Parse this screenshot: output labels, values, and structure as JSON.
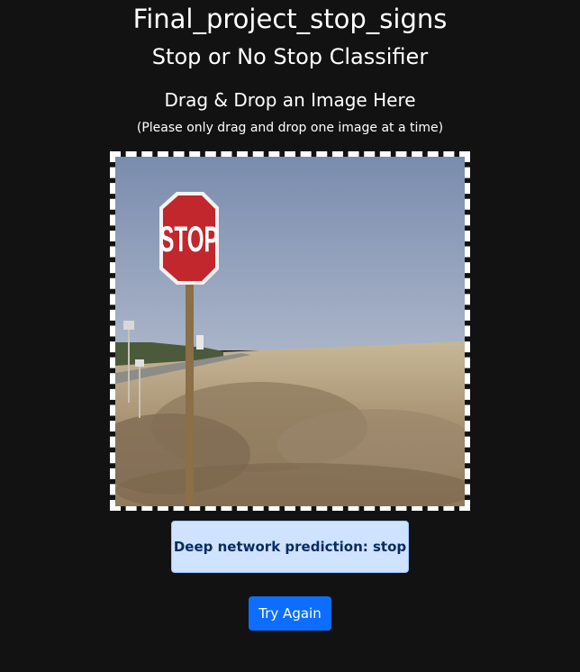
{
  "header": {
    "title": "Final_project_stop_signs",
    "subtitle": "Stop or No Stop Classifier"
  },
  "drop_zone": {
    "heading": "Drag & Drop an Image Here",
    "hint": "(Please only drag and drop one image at a time)",
    "image": {
      "sign_text": "STOP",
      "colors": {
        "sky": "#8fa0bd",
        "field": "#b09a7a",
        "sign": "#c1272d"
      }
    }
  },
  "result": {
    "prediction_text": "Deep network prediction: stop"
  },
  "actions": {
    "try_again_label": "Try Again"
  },
  "theme": {
    "background": "#121212",
    "alert_background": "#cfe2ff",
    "alert_text": "#052c65",
    "primary_button": "#0d6efd"
  }
}
